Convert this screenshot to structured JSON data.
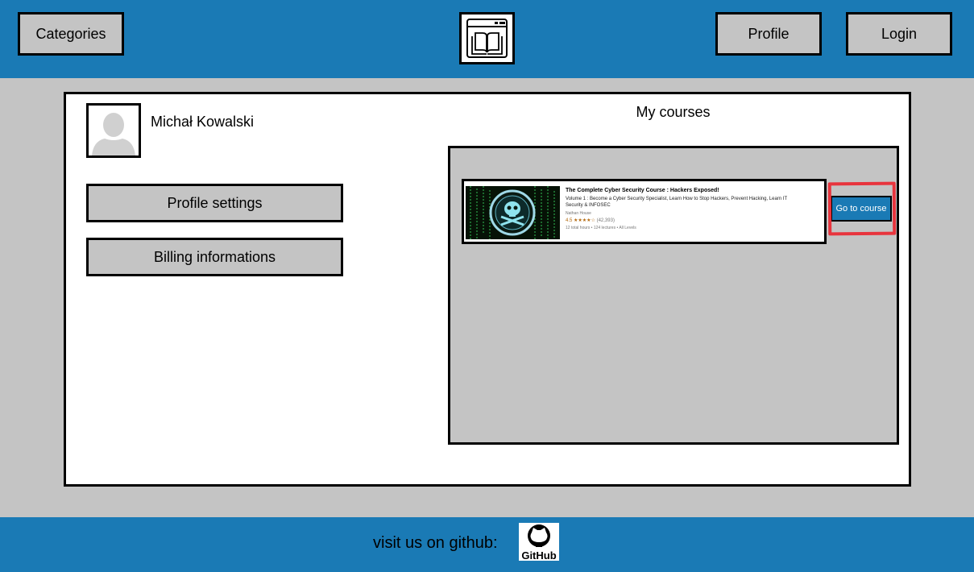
{
  "header": {
    "categories_label": "Categories",
    "profile_label": "Profile",
    "login_label": "Login",
    "logo_icon": "book-window-icon"
  },
  "user": {
    "name": "Michał Kowalski",
    "avatar_icon": "user-avatar-icon"
  },
  "sidebar": {
    "profile_settings_label": "Profile settings",
    "billing_label": "Billing informations"
  },
  "courses": {
    "title": "My courses",
    "items": [
      {
        "title": "The Complete Cyber Security Course : Hackers Exposed!",
        "description": "Volume 1 : Become a Cyber Security Specialist, Learn How to Stop Hackers, Prevent Hacking, Learn IT Security & INFOSEC",
        "author": "Nathan House",
        "rating": "4.5",
        "stars": "★★★★☆",
        "rating_count": "(42,393)",
        "meta": "12 total hours • 124 lectures • All Levels",
        "button_label": "Go to course"
      }
    ]
  },
  "footer": {
    "github_text": "visit us on github:",
    "github_logo_text": "GitHub"
  },
  "colors": {
    "primary": "#1a7ab5",
    "panel_gray": "#c4c4c4",
    "highlight": "#e8343d"
  }
}
